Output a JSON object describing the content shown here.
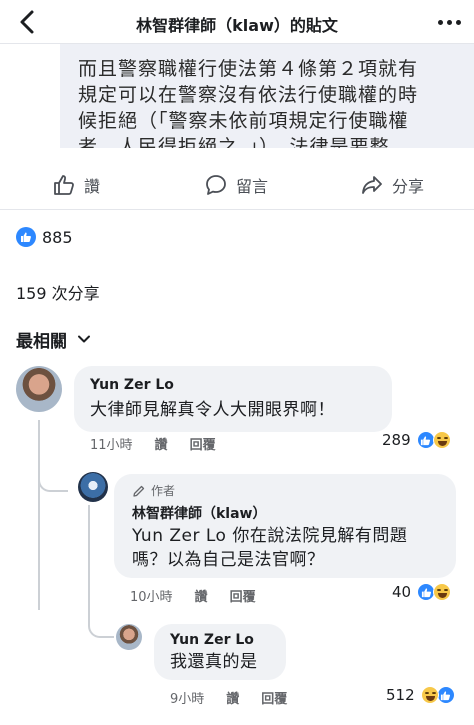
{
  "header": {
    "title": "林智群律師（klaw）的貼文"
  },
  "post": {
    "lines": [
      "而且警察職權行使法第４條第２項就有",
      "規定可以在警察沒有依法行使職權的時",
      "候拒絕（「警察未依前項規定行使職權",
      "者，人民得拒絕之。」）。法律是要整"
    ]
  },
  "actions": {
    "like": "讚",
    "comment": "留言",
    "share": "分享"
  },
  "reactions": {
    "count": "885"
  },
  "shares": "159 次分享",
  "sort": {
    "label": "最相關"
  },
  "comments": [
    {
      "name": "Yun Zer Lo",
      "text": "大律師見解真令人大開眼界啊！",
      "time": "11小時",
      "like": "讚",
      "reply": "回覆",
      "reaction_count": "289"
    },
    {
      "badge": "作者",
      "name": "林智群律師（klaw）",
      "text_lines": [
        "Yun Zer Lo 你在說法院見解有問題",
        "嗎？以為自己是法官啊？"
      ],
      "time": "10小時",
      "like": "讚",
      "reply": "回覆",
      "reaction_count": "40"
    },
    {
      "name": "Yun Zer Lo",
      "text": "我還真的是",
      "time": "9小時",
      "like": "讚",
      "reply": "回覆",
      "reaction_count": "512"
    }
  ],
  "colors": {
    "like_blue": "#2d88ff",
    "haha_yellow": "#f7c849",
    "bubble_gray": "#f0f2f5"
  }
}
